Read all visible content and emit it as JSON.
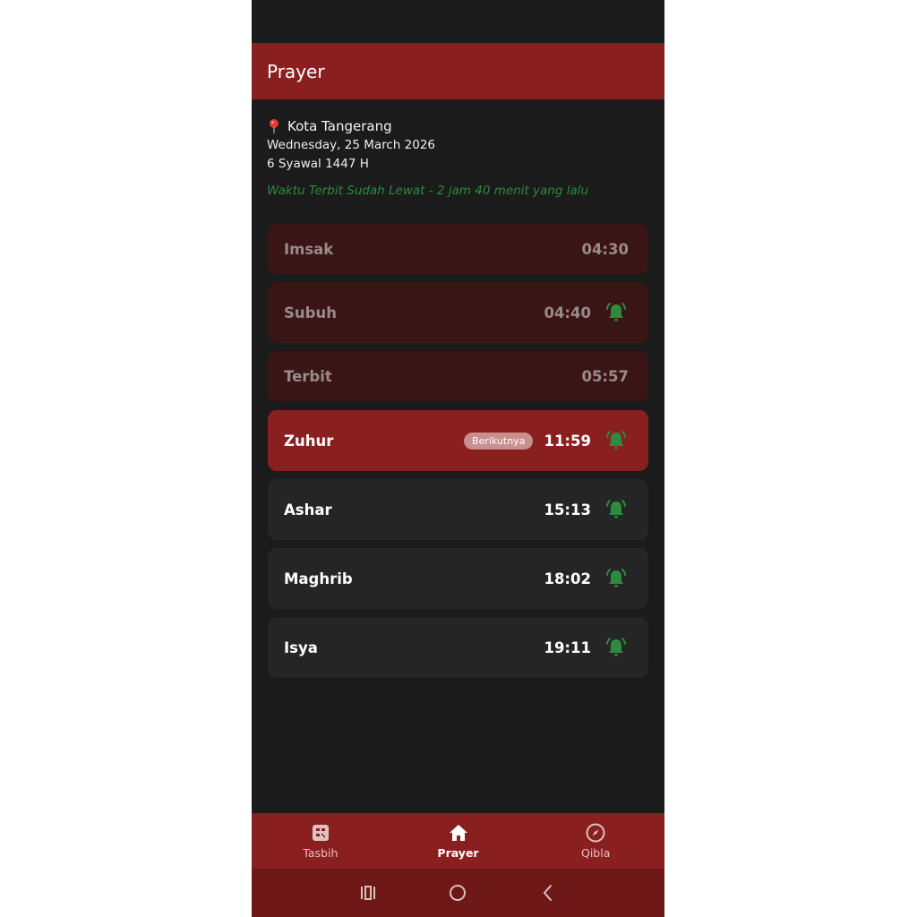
{
  "app_bar": {
    "title": "Prayer"
  },
  "info": {
    "location": "Kota Tangerang",
    "date": "Wednesday, 25 March 2026",
    "hijri": "6 Syawal 1447 H",
    "status_note": "Waktu Terbit Sudah Lewat - 2 jam 40 menit yang lalu"
  },
  "prayers": [
    {
      "name": "Imsak",
      "time": "04:30",
      "state": "past",
      "bell": false
    },
    {
      "name": "Subuh",
      "time": "04:40",
      "state": "past",
      "bell": true
    },
    {
      "name": "Terbit",
      "time": "05:57",
      "state": "past",
      "bell": false
    },
    {
      "name": "Zuhur",
      "time": "11:59",
      "state": "next",
      "bell": true,
      "badge": "Berikutnya"
    },
    {
      "name": "Ashar",
      "time": "15:13",
      "state": "upcoming",
      "bell": true
    },
    {
      "name": "Maghrib",
      "time": "18:02",
      "state": "upcoming",
      "bell": true
    },
    {
      "name": "Isya",
      "time": "19:11",
      "state": "upcoming",
      "bell": true
    }
  ],
  "bottom_nav": [
    {
      "label": "Tasbih",
      "icon": "calculator-icon",
      "active": false
    },
    {
      "label": "Prayer",
      "icon": "home-icon",
      "active": true
    },
    {
      "label": "Qibla",
      "icon": "compass-icon",
      "active": false
    }
  ],
  "colors": {
    "primary": "#8a1f1f",
    "background": "#1b1b1b",
    "past_row": "#3a1515",
    "upcoming_row": "#252525",
    "bell_green": "#2e8a3e",
    "badge": "#c98e8e"
  }
}
